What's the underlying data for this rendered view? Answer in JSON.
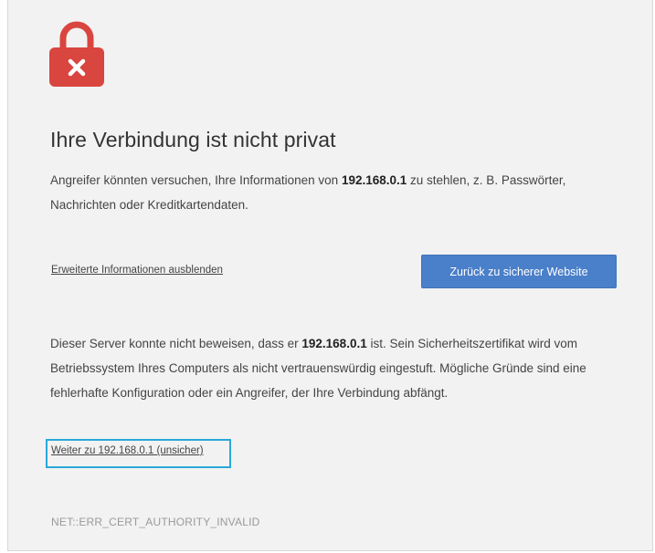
{
  "interstitial": {
    "title": "Ihre Verbindung ist nicht privat",
    "intro": {
      "before": "Angreifer könnten versuchen, Ihre Informationen von ",
      "host": "192.168.0.1",
      "after": " zu stehlen, z. B. Passwörter, Nachrichten oder Kreditkartendaten."
    },
    "details_link_label": "Erweiterte Informationen ausblenden",
    "back_button_label": "Zurück zu sicherer Website",
    "explanation": {
      "before": "Dieser Server konnte nicht beweisen, dass er ",
      "host": "192.168.0.1",
      "after": " ist. Sein Sicherheitszertifikat wird vom Betriebssystem Ihres Computers als nicht vertrauenswürdig eingestuft. Mögliche Gründe sind eine fehlerhafte Konfiguration oder ein Angreifer, der Ihre Verbindung abfängt."
    },
    "proceed_link_label": "Weiter zu 192.168.0.1 (unsicher)",
    "error_code": "NET::ERR_CERT_AUTHORITY_INVALID",
    "icon": "broken-lock-icon"
  },
  "colors": {
    "lock_red": "#d9453f",
    "button_blue": "#4a7fc9",
    "highlight_cyan": "#29a8d9",
    "background": "#f2f2f2"
  }
}
